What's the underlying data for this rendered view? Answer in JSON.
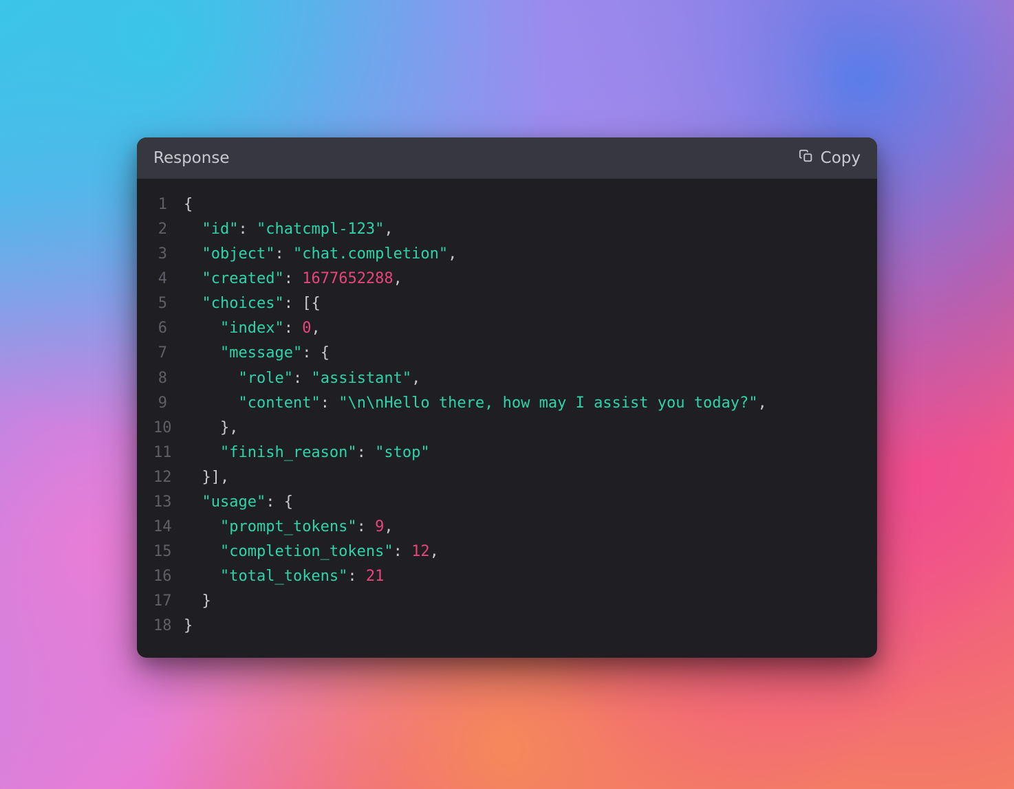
{
  "header": {
    "title": "Response",
    "copy_label": "Copy"
  },
  "code": {
    "lines": [
      {
        "num": "1",
        "tokens": [
          {
            "cls": "p",
            "t": "{"
          }
        ]
      },
      {
        "num": "2",
        "tokens": [
          {
            "cls": "p",
            "t": "  "
          },
          {
            "cls": "k",
            "t": "\"id\""
          },
          {
            "cls": "p",
            "t": ": "
          },
          {
            "cls": "s",
            "t": "\"chatcmpl-123\""
          },
          {
            "cls": "p",
            "t": ","
          }
        ]
      },
      {
        "num": "3",
        "tokens": [
          {
            "cls": "p",
            "t": "  "
          },
          {
            "cls": "k",
            "t": "\"object\""
          },
          {
            "cls": "p",
            "t": ": "
          },
          {
            "cls": "s",
            "t": "\"chat.completion\""
          },
          {
            "cls": "p",
            "t": ","
          }
        ]
      },
      {
        "num": "4",
        "tokens": [
          {
            "cls": "p",
            "t": "  "
          },
          {
            "cls": "k",
            "t": "\"created\""
          },
          {
            "cls": "p",
            "t": ": "
          },
          {
            "cls": "n",
            "t": "1677652288"
          },
          {
            "cls": "p",
            "t": ","
          }
        ]
      },
      {
        "num": "5",
        "tokens": [
          {
            "cls": "p",
            "t": "  "
          },
          {
            "cls": "k",
            "t": "\"choices\""
          },
          {
            "cls": "p",
            "t": ": [{"
          }
        ]
      },
      {
        "num": "6",
        "tokens": [
          {
            "cls": "p",
            "t": "    "
          },
          {
            "cls": "k",
            "t": "\"index\""
          },
          {
            "cls": "p",
            "t": ": "
          },
          {
            "cls": "n",
            "t": "0"
          },
          {
            "cls": "p",
            "t": ","
          }
        ]
      },
      {
        "num": "7",
        "tokens": [
          {
            "cls": "p",
            "t": "    "
          },
          {
            "cls": "k",
            "t": "\"message\""
          },
          {
            "cls": "p",
            "t": ": {"
          }
        ]
      },
      {
        "num": "8",
        "tokens": [
          {
            "cls": "p",
            "t": "      "
          },
          {
            "cls": "k",
            "t": "\"role\""
          },
          {
            "cls": "p",
            "t": ": "
          },
          {
            "cls": "s",
            "t": "\"assistant\""
          },
          {
            "cls": "p",
            "t": ","
          }
        ]
      },
      {
        "num": "9",
        "tokens": [
          {
            "cls": "p",
            "t": "      "
          },
          {
            "cls": "k",
            "t": "\"content\""
          },
          {
            "cls": "p",
            "t": ": "
          },
          {
            "cls": "s",
            "t": "\"\\n\\nHello there, how may I assist you today?\""
          },
          {
            "cls": "p",
            "t": ","
          }
        ]
      },
      {
        "num": "10",
        "tokens": [
          {
            "cls": "p",
            "t": "    },"
          }
        ]
      },
      {
        "num": "11",
        "tokens": [
          {
            "cls": "p",
            "t": "    "
          },
          {
            "cls": "k",
            "t": "\"finish_reason\""
          },
          {
            "cls": "p",
            "t": ": "
          },
          {
            "cls": "s",
            "t": "\"stop\""
          }
        ]
      },
      {
        "num": "12",
        "tokens": [
          {
            "cls": "p",
            "t": "  }],"
          }
        ]
      },
      {
        "num": "13",
        "tokens": [
          {
            "cls": "p",
            "t": "  "
          },
          {
            "cls": "k",
            "t": "\"usage\""
          },
          {
            "cls": "p",
            "t": ": {"
          }
        ]
      },
      {
        "num": "14",
        "tokens": [
          {
            "cls": "p",
            "t": "    "
          },
          {
            "cls": "k",
            "t": "\"prompt_tokens\""
          },
          {
            "cls": "p",
            "t": ": "
          },
          {
            "cls": "n",
            "t": "9"
          },
          {
            "cls": "p",
            "t": ","
          }
        ]
      },
      {
        "num": "15",
        "tokens": [
          {
            "cls": "p",
            "t": "    "
          },
          {
            "cls": "k",
            "t": "\"completion_tokens\""
          },
          {
            "cls": "p",
            "t": ": "
          },
          {
            "cls": "n",
            "t": "12"
          },
          {
            "cls": "p",
            "t": ","
          }
        ]
      },
      {
        "num": "16",
        "tokens": [
          {
            "cls": "p",
            "t": "    "
          },
          {
            "cls": "k",
            "t": "\"total_tokens\""
          },
          {
            "cls": "p",
            "t": ": "
          },
          {
            "cls": "n",
            "t": "21"
          }
        ]
      },
      {
        "num": "17",
        "tokens": [
          {
            "cls": "p",
            "t": "  }"
          }
        ]
      },
      {
        "num": "18",
        "tokens": [
          {
            "cls": "p",
            "t": "}"
          }
        ]
      }
    ]
  }
}
